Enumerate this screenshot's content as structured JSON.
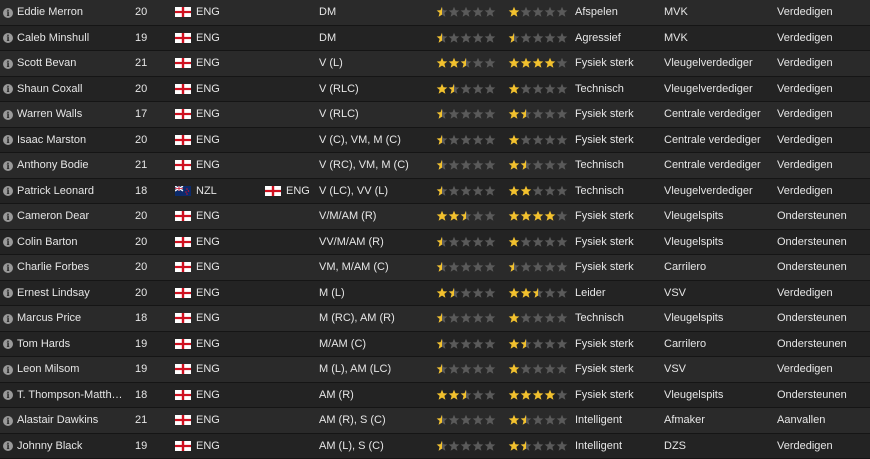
{
  "colors": {
    "star_gold": "#f2c12e",
    "star_empty": "#5a5a5a",
    "text": "#e6e6e6"
  },
  "players": [
    {
      "name": "Eddie Merron",
      "age": "20",
      "nat": "ENG",
      "nat2": "",
      "pos": "DM",
      "ca": 0.5,
      "pa": 1,
      "personality": "Afspelen",
      "role": "MVK",
      "duty": "Verdedigen"
    },
    {
      "name": "Caleb Minshull",
      "age": "19",
      "nat": "ENG",
      "nat2": "",
      "pos": "DM",
      "ca": 0.5,
      "pa": 0.5,
      "personality": "Agressief",
      "role": "MVK",
      "duty": "Verdedigen"
    },
    {
      "name": "Scott Bevan",
      "age": "21",
      "nat": "ENG",
      "nat2": "",
      "pos": "V (L)",
      "ca": 2.5,
      "pa": 4,
      "personality": "Fysiek sterk",
      "role": "Vleugelverdediger",
      "duty": "Verdedigen"
    },
    {
      "name": "Shaun Coxall",
      "age": "20",
      "nat": "ENG",
      "nat2": "",
      "pos": "V (RLC)",
      "ca": 1.5,
      "pa": 1,
      "personality": "Technisch",
      "role": "Vleugelverdediger",
      "duty": "Verdedigen"
    },
    {
      "name": "Warren Walls",
      "age": "17",
      "nat": "ENG",
      "nat2": "",
      "pos": "V (RLC)",
      "ca": 0.5,
      "pa": 1.5,
      "personality": "Fysiek sterk",
      "role": "Centrale verdediger",
      "duty": "Verdedigen"
    },
    {
      "name": "Isaac Marston",
      "age": "20",
      "nat": "ENG",
      "nat2": "",
      "pos": "V (C), VM, M (C)",
      "ca": 0.5,
      "pa": 1,
      "personality": "Fysiek sterk",
      "role": "Centrale verdediger",
      "duty": "Verdedigen"
    },
    {
      "name": "Anthony Bodie",
      "age": "21",
      "nat": "ENG",
      "nat2": "",
      "pos": "V (RC), VM, M (C)",
      "ca": 0.5,
      "pa": 1.5,
      "personality": "Technisch",
      "role": "Centrale verdediger",
      "duty": "Verdedigen"
    },
    {
      "name": "Patrick Leonard",
      "age": "18",
      "nat": "NZL",
      "nat2": "ENG",
      "pos": "V (LC), VV (L)",
      "ca": 0.5,
      "pa": 2,
      "personality": "Technisch",
      "role": "Vleugelverdediger",
      "duty": "Verdedigen"
    },
    {
      "name": "Cameron Dear",
      "age": "20",
      "nat": "ENG",
      "nat2": "",
      "pos": "V/M/AM (R)",
      "ca": 2.5,
      "pa": 4,
      "personality": "Fysiek sterk",
      "role": "Vleugelspits",
      "duty": "Ondersteunen"
    },
    {
      "name": "Colin Barton",
      "age": "20",
      "nat": "ENG",
      "nat2": "",
      "pos": "VV/M/AM (R)",
      "ca": 0.5,
      "pa": 1,
      "personality": "Fysiek sterk",
      "role": "Vleugelspits",
      "duty": "Ondersteunen"
    },
    {
      "name": "Charlie Forbes",
      "age": "20",
      "nat": "ENG",
      "nat2": "",
      "pos": "VM, M/AM (C)",
      "ca": 0.5,
      "pa": 0.5,
      "personality": "Fysiek sterk",
      "role": "Carrilero",
      "duty": "Ondersteunen"
    },
    {
      "name": "Ernest Lindsay",
      "age": "20",
      "nat": "ENG",
      "nat2": "",
      "pos": "M (L)",
      "ca": 1.5,
      "pa": 2.5,
      "personality": "Leider",
      "role": "VSV",
      "duty": "Verdedigen"
    },
    {
      "name": "Marcus Price",
      "age": "18",
      "nat": "ENG",
      "nat2": "",
      "pos": "M (RC), AM (R)",
      "ca": 0.5,
      "pa": 1,
      "personality": "Technisch",
      "role": "Vleugelspits",
      "duty": "Ondersteunen"
    },
    {
      "name": "Tom Hards",
      "age": "19",
      "nat": "ENG",
      "nat2": "",
      "pos": "M/AM (C)",
      "ca": 0.5,
      "pa": 1.5,
      "personality": "Fysiek sterk",
      "role": "Carrilero",
      "duty": "Ondersteunen"
    },
    {
      "name": "Leon Milsom",
      "age": "19",
      "nat": "ENG",
      "nat2": "",
      "pos": "M (L), AM (LC)",
      "ca": 0.5,
      "pa": 1,
      "personality": "Fysiek sterk",
      "role": "VSV",
      "duty": "Verdedigen"
    },
    {
      "name": "T. Thompson-Matth…",
      "age": "18",
      "nat": "ENG",
      "nat2": "",
      "pos": "AM (R)",
      "ca": 2.5,
      "pa": 4,
      "personality": "Fysiek sterk",
      "role": "Vleugelspits",
      "duty": "Ondersteunen"
    },
    {
      "name": "Alastair Dawkins",
      "age": "21",
      "nat": "ENG",
      "nat2": "",
      "pos": "AM (R), S (C)",
      "ca": 0.5,
      "pa": 1.5,
      "personality": "Intelligent",
      "role": "Afmaker",
      "duty": "Aanvallen"
    },
    {
      "name": "Johnny Black",
      "age": "19",
      "nat": "ENG",
      "nat2": "",
      "pos": "AM (L), S (C)",
      "ca": 0.5,
      "pa": 1.5,
      "personality": "Intelligent",
      "role": "DZS",
      "duty": "Verdedigen"
    }
  ]
}
